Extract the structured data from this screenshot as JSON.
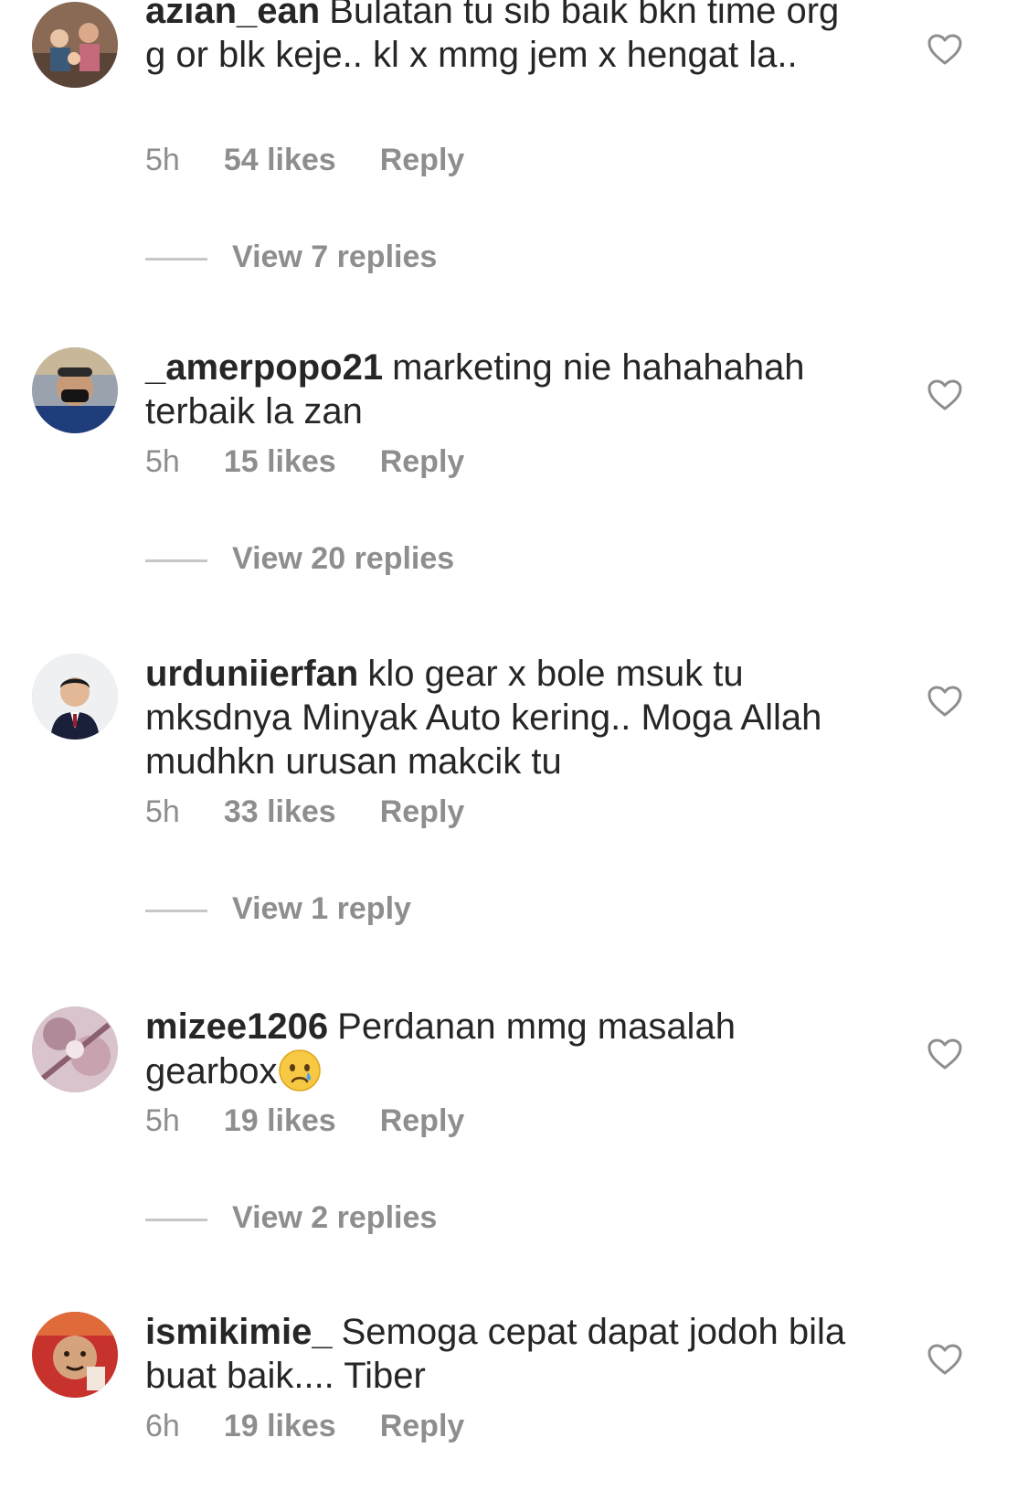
{
  "comments": [
    {
      "username": "azian_ean",
      "text": "Bulatan tu sib baik bkn time org g or blk keje.. kl x mmg jem x hengat la..",
      "time": "5h",
      "likes": "54 likes",
      "reply_label": "Reply",
      "view_replies": "View 7 replies"
    },
    {
      "username": "_amerpopo21",
      "text": "marketing nie hahahahah terbaik la zan",
      "time": "5h",
      "likes": "15 likes",
      "reply_label": "Reply",
      "view_replies": "View 20 replies"
    },
    {
      "username": "urduniierfan",
      "text": "klo gear x bole msuk tu mksdnya Minyak Auto kering.. Moga Allah mudhkn urusan makcik tu",
      "time": "5h",
      "likes": "33 likes",
      "reply_label": "Reply",
      "view_replies": "View 1 reply"
    },
    {
      "username": "mizee1206",
      "text": "Perdanan mmg masalah gearbox",
      "emoji": "crying-face-emoji",
      "time": "5h",
      "likes": "19 likes",
      "reply_label": "Reply",
      "view_replies": "View 2 replies"
    },
    {
      "username": "ismikimie_",
      "text": "Semoga cepat dapat jodoh bila buat baik.... Tiber",
      "time": "6h",
      "likes": "19 likes",
      "reply_label": "Reply"
    }
  ],
  "icons": {
    "like": "heart-outline-icon"
  },
  "colors": {
    "text": "#262626",
    "meta": "#8e8e8e",
    "divider": "#c7c7c7"
  }
}
